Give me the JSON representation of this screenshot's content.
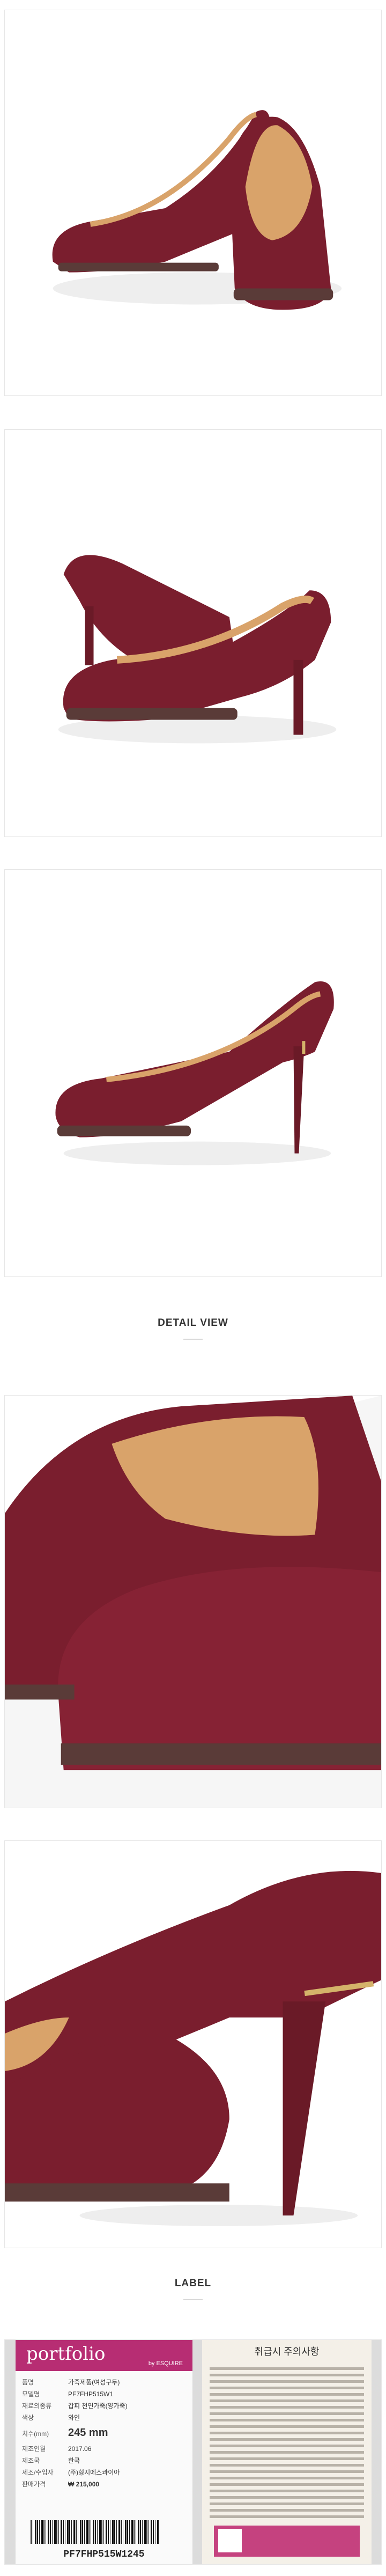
{
  "sections": {
    "detail_view": "DETAIL VIEW",
    "label": "LABEL"
  },
  "label_tag": {
    "brand": "portfolio",
    "brand_sub": "by ESQUIRE",
    "rows": [
      {
        "key": "품명",
        "value": "가죽제품(여성구두)"
      },
      {
        "key": "모델명",
        "value": "PF7FHP515W1"
      },
      {
        "key": "재료의종류",
        "value": "갑피 천연가죽(양가죽)"
      },
      {
        "key": "색상",
        "value": "와인"
      },
      {
        "key": "치수(mm)",
        "value": "245 mm"
      },
      {
        "key": "제조연월",
        "value": "2017.06"
      },
      {
        "key": "제조국",
        "value": "한국"
      },
      {
        "key": "제조/수입자",
        "value": "(주)형지에스콰이아"
      },
      {
        "key": "판매가격",
        "value": "₩ 215,000"
      }
    ],
    "barcode_text": "PF7FHP515W1245"
  },
  "care_tag": {
    "title": "취급시 주의사항"
  },
  "colors": {
    "leather": "#7a1e2e",
    "lining": "#d9a36a",
    "brand": "#b72d73"
  }
}
